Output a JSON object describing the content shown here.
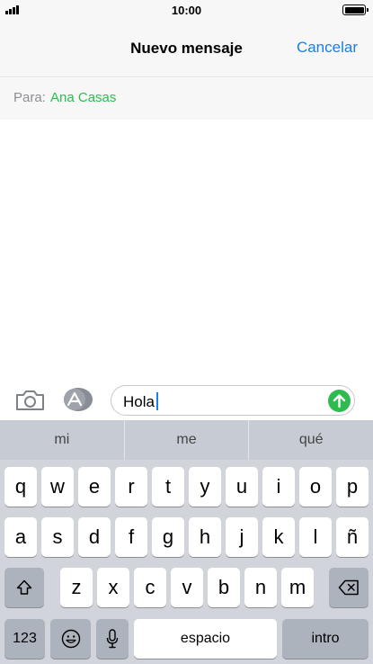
{
  "status_bar": {
    "time": "10:00"
  },
  "nav": {
    "title": "Nuevo mensaje",
    "cancel_label": "Cancelar"
  },
  "to_field": {
    "label": "Para:",
    "recipient": "Ana Casas"
  },
  "compose": {
    "text": "Hola"
  },
  "icons": {
    "camera": "camera-icon",
    "apps": "app-store-icon",
    "send": "arrow-up-icon",
    "shift": "shift-arrow-icon",
    "backspace": "backspace-icon",
    "emoji": "emoji-icon",
    "mic": "microphone-icon"
  },
  "keyboard": {
    "predictions": [
      "mi",
      "me",
      "qué"
    ],
    "row1": [
      "q",
      "w",
      "e",
      "r",
      "t",
      "y",
      "u",
      "i",
      "o",
      "p"
    ],
    "row2": [
      "a",
      "s",
      "d",
      "f",
      "g",
      "h",
      "j",
      "k",
      "l",
      "ñ"
    ],
    "row3": [
      "z",
      "x",
      "c",
      "v",
      "b",
      "n",
      "m"
    ],
    "numbers_label": "123",
    "space_label": "espacio",
    "return_label": "intro"
  },
  "colors": {
    "accent_blue": "#1a7ef0",
    "send_green": "#2dbb4f",
    "keyboard_bg": "#d1d4db"
  }
}
